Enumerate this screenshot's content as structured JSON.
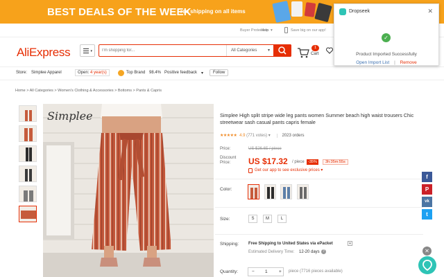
{
  "banner": {
    "headline": "BEST DEALS OF THE WEEK",
    "subtext": "Free shipping on all items"
  },
  "utility": {
    "buyer_protection": "Buyer Protection",
    "help": "Help",
    "app": "Save big on our app!"
  },
  "header": {
    "logo": "AliExpress",
    "search_placeholder": "I'm shopping for...",
    "category": "All Categories",
    "cart_label": "Cart",
    "cart_count": "1"
  },
  "store": {
    "label": "Store:",
    "name": "Simplee Apparel",
    "open_label": "Open:",
    "open_years": "4 year(s)",
    "top_brand": "Top Brand",
    "feedback_pct": "98.4%",
    "feedback_label": "Positive feedback",
    "follow": "Follow"
  },
  "breadcrumb": "Home > All Categories > Women's Clothing & Accessories > Bottoms > Pants & Capris",
  "product": {
    "brand_watermark": "Simplee",
    "title": "Simplee High split stripe wide leg pants women Summer beach high waist trousers Chic streetwear sash casual pants capris female",
    "stars": "★★★★★",
    "rating": "4.9",
    "votes": "(771 votes)",
    "orders": "2023 orders",
    "price_label": "Price:",
    "old_price": "US $26.65 / piece",
    "discount_label": "Discount Price:",
    "new_price": "US $17.32",
    "per_piece": "/ piece",
    "discount": "-35%",
    "timer": "3h:35m:55s",
    "app_price": "Get our app to see exclusive prices ▾",
    "color_label": "Color:",
    "size_label": "Size:",
    "sizes": [
      "S",
      "M",
      "L"
    ],
    "shipping_label": "Shipping:",
    "shipping_text": "Free Shipping to United States via ePacket",
    "delivery_label": "Estimated Delivery Time:",
    "delivery_days": "12-20 days",
    "quantity_label": "Quantity:",
    "qty_minus": "−",
    "qty_value": "1",
    "qty_plus": "+",
    "available": "piece (7716 pieces available)"
  },
  "popup": {
    "title": "Dropseek",
    "close": "✕",
    "message": "Product Imported Successfully",
    "open_link": "Open Import List",
    "separator": "|",
    "remove_link": "Remove"
  },
  "social": [
    {
      "name": "facebook",
      "glyph": "f",
      "color": "#3b5998"
    },
    {
      "name": "pinterest",
      "glyph": "P",
      "color": "#cb2027"
    },
    {
      "name": "vk",
      "glyph": "vk",
      "color": "#4c75a3"
    },
    {
      "name": "twitter",
      "glyph": "t",
      "color": "#1da1f2"
    }
  ],
  "colors": {
    "accent": "#e62e04",
    "banner": "#f7a21b",
    "dropseek": "#2ec4b6"
  }
}
